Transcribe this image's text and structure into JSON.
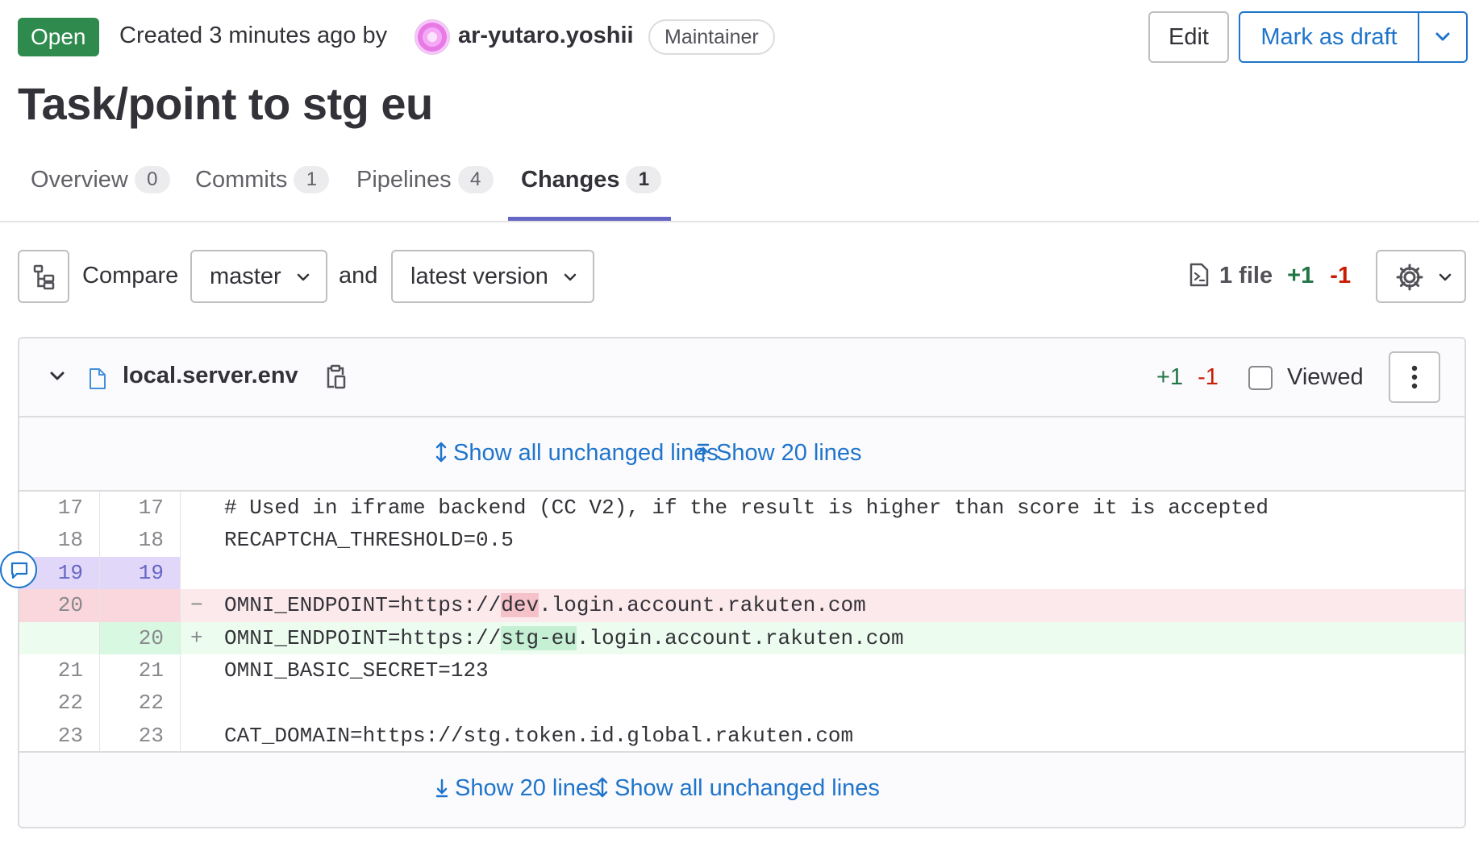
{
  "header": {
    "status": "Open",
    "created_text": "Created 3 minutes ago by",
    "author": "ar-yutaro.yoshii",
    "role": "Maintainer",
    "edit_label": "Edit",
    "draft_label": "Mark as draft"
  },
  "title": "Task/point to stg eu",
  "tabs": [
    {
      "label": "Overview",
      "count": "0"
    },
    {
      "label": "Commits",
      "count": "1"
    },
    {
      "label": "Pipelines",
      "count": "4"
    },
    {
      "label": "Changes",
      "count": "1"
    }
  ],
  "compare": {
    "label": "Compare",
    "source": "master",
    "and_label": "and",
    "target": "latest version",
    "file_count": "1 file",
    "additions": "+1",
    "deletions": "-1"
  },
  "file": {
    "name": "local.server.env",
    "additions": "+1",
    "deletions": "-1",
    "viewed_label": "Viewed",
    "expand_top": {
      "all": "Show all unchanged lines",
      "up": "Show 20 lines"
    },
    "expand_bottom": {
      "down": "Show 20 lines",
      "all": "Show all unchanged lines"
    },
    "lines": [
      {
        "old": "17",
        "new": "17",
        "sign": "",
        "code": "# Used in iframe backend (CC V2), if the result is higher than score it is accepted"
      },
      {
        "old": "18",
        "new": "18",
        "sign": "",
        "code": "RECAPTCHA_THRESHOLD=0.5"
      },
      {
        "old": "19",
        "new": "19",
        "sign": "",
        "code": ""
      },
      {
        "old": "20",
        "new": "",
        "sign": "−",
        "code_pre": "OMNI_ENDPOINT=https://",
        "code_mark": "dev",
        "code_post": ".login.account.rakuten.com"
      },
      {
        "old": "",
        "new": "20",
        "sign": "+",
        "code_pre": "OMNI_ENDPOINT=https://",
        "code_mark": "stg-eu",
        "code_post": ".login.account.rakuten.com"
      },
      {
        "old": "21",
        "new": "21",
        "sign": "",
        "code": "OMNI_BASIC_SECRET=123"
      },
      {
        "old": "22",
        "new": "22",
        "sign": "",
        "code": ""
      },
      {
        "old": "23",
        "new": "23",
        "sign": "",
        "code": "CAT_DOMAIN=https://stg.token.id.global.rakuten.com"
      }
    ]
  },
  "colors": {
    "status_green": "#2f8a4d",
    "link_blue": "#1f75cb",
    "tab_underline": "#6666c4",
    "added": "#217645",
    "removed": "#c91c00"
  },
  "icons": [
    "chevron-down-icon",
    "file-tree-icon",
    "file-diff-icon",
    "gear-icon",
    "file-icon",
    "copy-icon",
    "kebab-icon",
    "expand-icon",
    "expand-up-icon",
    "expand-down-icon",
    "comment-icon"
  ]
}
